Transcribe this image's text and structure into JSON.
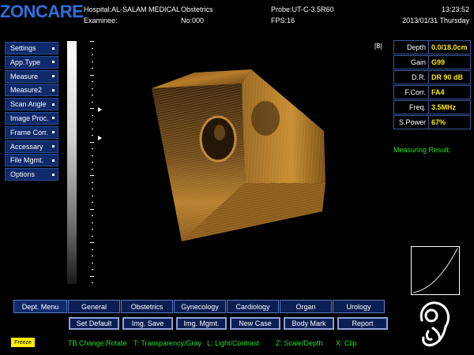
{
  "header": {
    "logo": "ZONCARE",
    "hospital": "Hospital:AL-SALAM MEDICAL",
    "department": "Obstetrics",
    "examinee": "Examinee:",
    "number": "No:000",
    "probe": "Probe:UT-C-3.5R60",
    "fps": "FPS:16",
    "time": "13:23:52",
    "date": "2013/01/31 Thursday"
  },
  "left_menu": [
    {
      "label": "Settings"
    },
    {
      "label": "App.Type"
    },
    {
      "label": "Measure"
    },
    {
      "label": "Measure2"
    },
    {
      "label": "Scan Angle"
    },
    {
      "label": "Image Proc."
    },
    {
      "label": "Frame Corr."
    },
    {
      "label": "Accessary"
    },
    {
      "label": "File Mgmt."
    },
    {
      "label": "Options"
    }
  ],
  "frame_indicator": "[B]",
  "params": [
    {
      "label": "Depth",
      "value": "0.0/18.0cm"
    },
    {
      "label": "Gain",
      "value": "G99"
    },
    {
      "label": "D.R.",
      "value": "DR 90 dB"
    },
    {
      "label": "F.Corr.",
      "value": "FA4"
    },
    {
      "label": "Freq.",
      "value": "3.5MHz"
    },
    {
      "label": "S.Power",
      "value": "67%"
    }
  ],
  "measuring_result": "Measuring Result:",
  "dept_menu": "Dept. Menu",
  "dept_tabs": [
    {
      "label": "General"
    },
    {
      "label": "Obstetrics"
    },
    {
      "label": "Gynecology"
    },
    {
      "label": "Cardiology"
    },
    {
      "label": "Organ"
    },
    {
      "label": "Urology"
    }
  ],
  "actions": [
    {
      "label": "Set Default"
    },
    {
      "label": "Img. Save"
    },
    {
      "label": "Img. Mgmt."
    },
    {
      "label": "New Case"
    },
    {
      "label": "Body Mark"
    },
    {
      "label": "Report"
    }
  ],
  "freeze_label": "Freeze",
  "hints": {
    "tb": "TB Change:Rotate",
    "t": "T: Transparency/Gray",
    "l": "L: Light/Contrast",
    "z": "Z: Scale/Depth",
    "x": "X: Clip"
  },
  "colors": {
    "logo": "#2d6fe0",
    "param_value": "#ffe600",
    "measuring_text": "#22dd33",
    "hint_text": "#22dd33",
    "freeze_bg": "#ffee00",
    "button_bg": "#0a1e54",
    "volume_tint": "#c8862a"
  },
  "icons": {
    "play_markers": "triangle-right-icon",
    "body_mark": "fetus-icon"
  }
}
